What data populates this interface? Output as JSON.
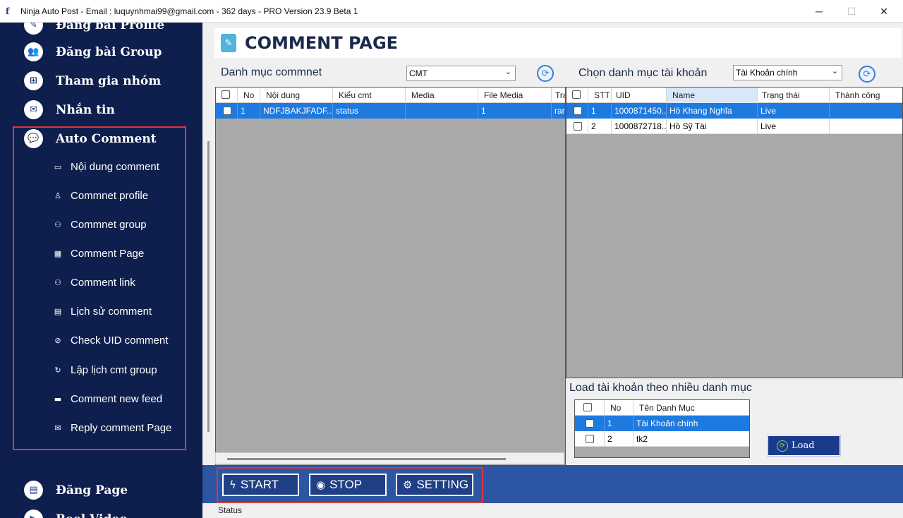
{
  "window": {
    "title": "Ninja Auto Post - Email : luquynhmai99@gmail.com - 362 days -  PRO Version 23.9 Beta 1",
    "app_icon": "f",
    "minimize": "─",
    "maximize": "☐",
    "close": "✕"
  },
  "sidebar": {
    "top_item": {
      "label": "Đăng bài Profile",
      "icon": "pen-icon"
    },
    "items": [
      {
        "label": "Đăng bài Group",
        "icon": "group-icon",
        "glyph": "👥"
      },
      {
        "label": "Tham gia nhóm",
        "icon": "join-group-icon",
        "glyph": "⊞"
      },
      {
        "label": "Nhắn tin",
        "icon": "message-icon",
        "glyph": "✉"
      },
      {
        "label": "Auto Comment",
        "icon": "comment-icon",
        "glyph": "💬"
      }
    ],
    "sub_items": [
      {
        "label": "Nội dung comment",
        "icon": "comment-content-icon",
        "glyph": "▭"
      },
      {
        "label": "Commnet profile",
        "icon": "profile-icon",
        "glyph": "♙"
      },
      {
        "label": "Commnet group",
        "icon": "group-users-icon",
        "glyph": "⚇"
      },
      {
        "label": "Comment Page",
        "icon": "page-icon",
        "glyph": "▦"
      },
      {
        "label": "Comment link",
        "icon": "link-users-icon",
        "glyph": "⚇"
      },
      {
        "label": "Lịch sử comment",
        "icon": "history-icon",
        "glyph": "▤"
      },
      {
        "label": "Check UID comment",
        "icon": "check-circle-icon",
        "glyph": "⊘"
      },
      {
        "label": "Lập lịch cmt group",
        "icon": "schedule-icon",
        "glyph": "↻"
      },
      {
        "label": "Comment new feed",
        "icon": "feed-icon",
        "glyph": "▬"
      },
      {
        "label": "Reply comment Page",
        "icon": "reply-icon",
        "glyph": "✉"
      }
    ],
    "bottom_items": [
      {
        "label": "Đăng Page",
        "icon": "page-doc-icon",
        "glyph": "▤"
      },
      {
        "label": "Reel Video",
        "icon": "video-icon",
        "glyph": "▶"
      }
    ]
  },
  "page": {
    "title": "COMMENT PAGE",
    "title_icon": "✎"
  },
  "left_panel": {
    "label": "Danh mục commnet",
    "combo_value": "CMT",
    "columns": [
      "No",
      "Nội dung",
      "Kiểu cmt",
      "Media",
      "File Media",
      "Tra"
    ],
    "rows": [
      {
        "no": "1",
        "content": "NDFJBAKJFADF...",
        "type": "status",
        "media": "",
        "file_media": "1",
        "extra": "rand"
      }
    ]
  },
  "right_panel": {
    "label": "Chọn danh mục tài khoản",
    "combo_value": "Tài Khoản chính",
    "columns": [
      "STT",
      "UID",
      "Name",
      "Trạng thái",
      "Thành công"
    ],
    "rows": [
      {
        "stt": "1",
        "uid": "1000871450...",
        "name": "Hồ Khang Nghĩa",
        "status": "Live",
        "success": ""
      },
      {
        "stt": "2",
        "uid": "1000872718...",
        "name": "Hồ Sỹ Tài",
        "status": "Live",
        "success": ""
      }
    ]
  },
  "category_panel": {
    "label": "Load tài khoản theo nhiều danh mục",
    "columns": [
      "No",
      "Tên Danh Mục"
    ],
    "rows": [
      {
        "no": "1",
        "name": "Tài Khoản chính"
      },
      {
        "no": "2",
        "name": "tk2"
      }
    ],
    "load_button": "Load",
    "load_glyph": "⟳"
  },
  "actions": {
    "start": {
      "label": "START",
      "glyph": "ϟ"
    },
    "stop": {
      "label": "STOP",
      "glyph": "◉"
    },
    "setting": {
      "label": "SETTING",
      "glyph": "⚙"
    }
  },
  "status_bar": {
    "text": "Status"
  },
  "colors": {
    "sidebar_bg": "#0f1f4d",
    "selection": "#1f7ae0",
    "button_bar": "#2c56a3",
    "highlight_border": "#d63a3a"
  }
}
